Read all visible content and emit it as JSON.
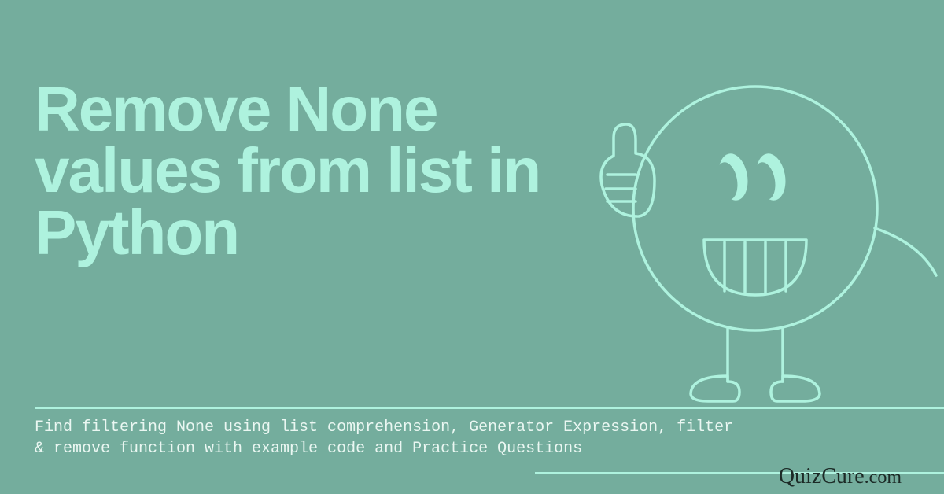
{
  "title": "Remove None values from list in Python",
  "subtitle": "Find filtering None using list comprehension, Generator Expression, filter & remove function with example code and Practice Questions",
  "site_name": "QuizCure",
  "site_suffix": ".com",
  "colors": {
    "background": "#74ad9d",
    "accent": "#aef2de",
    "text_light": "#eaf7f2",
    "site_text": "#1c2a26"
  },
  "mascot": {
    "description": "smiling-circle-character-thumbs-up"
  }
}
